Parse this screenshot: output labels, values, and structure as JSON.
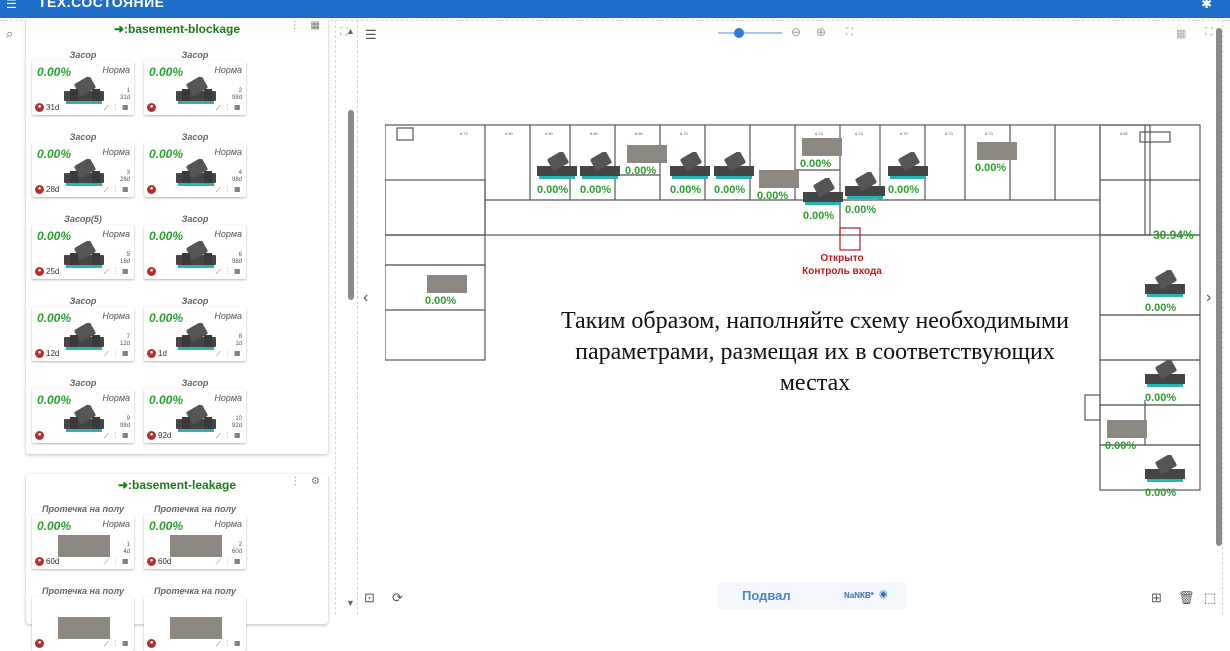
{
  "topbar": {
    "title": "ТЕХ.СОСТОЯНИЕ"
  },
  "groups": [
    {
      "title": "basement-blockage",
      "cells": [
        {
          "label": "Засор",
          "pct": "0.00%",
          "status": "Норма",
          "num": "1",
          "days_small": "31d",
          "days": "31d"
        },
        {
          "label": "Засор",
          "pct": "0.00%",
          "status": "Норма",
          "num": "2",
          "days_small": "98d",
          "days": ""
        },
        {
          "label": "Засор",
          "pct": "0.00%",
          "status": "Норма",
          "num": "3",
          "days_small": "28d",
          "days": "28d"
        },
        {
          "label": "Засор",
          "pct": "0.00%",
          "status": "Норма",
          "num": "4",
          "days_small": "98d",
          "days": ""
        },
        {
          "label": "Засор(5)",
          "pct": "0.00%",
          "status": "Норма",
          "num": "5",
          "days_small": "18d",
          "days": "25d"
        },
        {
          "label": "Засор",
          "pct": "0.00%",
          "status": "Норма",
          "num": "6",
          "days_small": "98d",
          "days": ""
        },
        {
          "label": "Засор",
          "pct": "0.00%",
          "status": "Норма",
          "num": "7",
          "days_small": "12d",
          "days": "12d"
        },
        {
          "label": "Засор",
          "pct": "0.00%",
          "status": "Норма",
          "num": "8",
          "days_small": "1d",
          "days": "1d"
        },
        {
          "label": "Засор",
          "pct": "0.00%",
          "status": "Норма",
          "num": "9",
          "days_small": "98d",
          "days": ""
        },
        {
          "label": "Засор",
          "pct": "0.00%",
          "status": "Норма",
          "num": "10",
          "days_small": "92d",
          "days": "92d"
        }
      ]
    },
    {
      "title": "basement-leakage",
      "cells": [
        {
          "label": "Протечка на полу",
          "pct": "0.00%",
          "status": "Норма",
          "num": "1",
          "days_small": "4d",
          "days": "60d"
        },
        {
          "label": "Протечка на полу",
          "pct": "0.00%",
          "status": "Норма",
          "num": "2",
          "days_small": "60d",
          "days": "60d"
        },
        {
          "label": "Протечка на полу",
          "pct": "",
          "status": "",
          "num": "",
          "days_small": "",
          "days": ""
        },
        {
          "label": "Протечка на полу",
          "pct": "",
          "status": "",
          "num": "",
          "days_small": "",
          "days": ""
        }
      ]
    }
  ],
  "map": {
    "sensor_pct": "0.00%",
    "door_status": "Открыто",
    "door_label": "Контроль входа",
    "big_pct": "30.94%",
    "caption": "Таким образом, наполняйте схему необходимыми параметрами, размещая их в соответствующих местах"
  },
  "bottom": {
    "floor": "Подвал",
    "nan": "NaNКВ*"
  },
  "colors": {
    "accent": "#1f6fc9",
    "ok": "#2ea02e",
    "alert": "#c0161b"
  }
}
